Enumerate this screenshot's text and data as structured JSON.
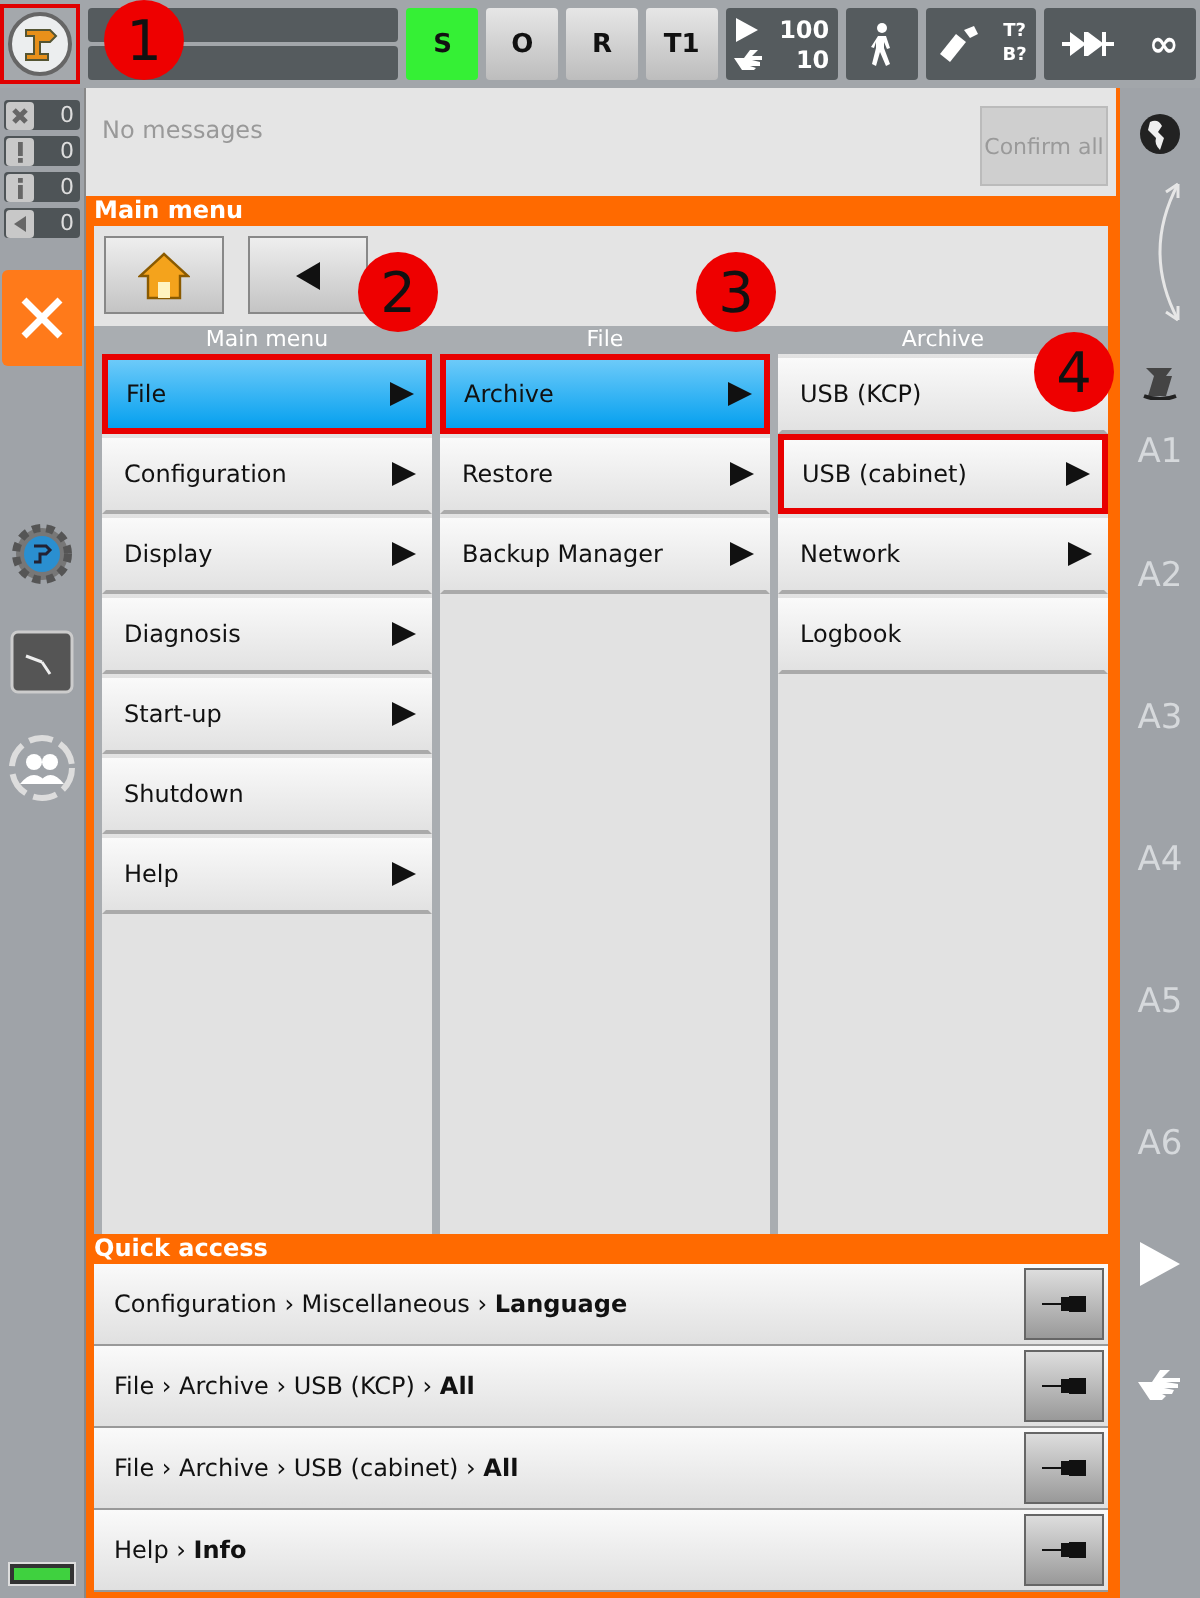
{
  "top_bar": {
    "logo": {
      "highlighted": true,
      "annotation": "1"
    },
    "modes": [
      {
        "label": "S",
        "selected": true
      },
      {
        "label": "O",
        "selected": false
      },
      {
        "label": "R",
        "selected": false
      },
      {
        "label": "T1",
        "selected": false
      }
    ],
    "program_override": "100",
    "jog_override": "10",
    "tool": "T?",
    "base": "B?",
    "step_mode": "∞"
  },
  "counters": [
    {
      "kind": "error",
      "count": "0"
    },
    {
      "kind": "warning",
      "count": "0"
    },
    {
      "kind": "info",
      "count": "0"
    },
    {
      "kind": "wait",
      "count": "0"
    }
  ],
  "messages": {
    "text": "No messages",
    "confirm_button": {
      "label": "Confirm all",
      "disabled": true
    }
  },
  "main_menu": {
    "title": "Main menu",
    "columns": [
      {
        "header": "Main menu",
        "items": [
          {
            "label": "File",
            "has_submenu": true,
            "selected": true,
            "highlighted": true,
            "annotation": "2"
          },
          {
            "label": "Configuration",
            "has_submenu": true,
            "selected": false,
            "highlighted": false
          },
          {
            "label": "Display",
            "has_submenu": true,
            "selected": false,
            "highlighted": false
          },
          {
            "label": "Diagnosis",
            "has_submenu": true,
            "selected": false,
            "highlighted": false
          },
          {
            "label": "Start-up",
            "has_submenu": true,
            "selected": false,
            "highlighted": false
          },
          {
            "label": "Shutdown",
            "has_submenu": false,
            "selected": false,
            "highlighted": false
          },
          {
            "label": "Help",
            "has_submenu": true,
            "selected": false,
            "highlighted": false
          }
        ]
      },
      {
        "header": "File",
        "items": [
          {
            "label": "Archive",
            "has_submenu": true,
            "selected": true,
            "highlighted": true,
            "annotation": "3"
          },
          {
            "label": "Restore",
            "has_submenu": true,
            "selected": false,
            "highlighted": false
          },
          {
            "label": "Backup Manager",
            "has_submenu": true,
            "selected": false,
            "highlighted": false
          }
        ]
      },
      {
        "header": "Archive",
        "items": [
          {
            "label": "USB (KCP)",
            "selected": false,
            "highlighted": false
          },
          {
            "label": "USB (cabinet)",
            "has_submenu": true,
            "selected": false,
            "highlighted": true,
            "annotation": "4"
          },
          {
            "label": "Network",
            "has_submenu": true,
            "selected": false,
            "highlighted": false
          },
          {
            "label": "Logbook",
            "has_submenu": false,
            "selected": false,
            "highlighted": false
          }
        ]
      }
    ]
  },
  "quick_access": {
    "title": "Quick access",
    "items": [
      {
        "path": "Configuration › Miscellaneous › **Language**"
      },
      {
        "path": "File › Archive › USB (KCP) › **All**"
      },
      {
        "path": "File › Archive › USB (cabinet) › **All**"
      },
      {
        "path": "Help › **Info**"
      }
    ]
  },
  "axes": [
    "A1",
    "A2",
    "A3",
    "A4",
    "A5",
    "A6"
  ]
}
